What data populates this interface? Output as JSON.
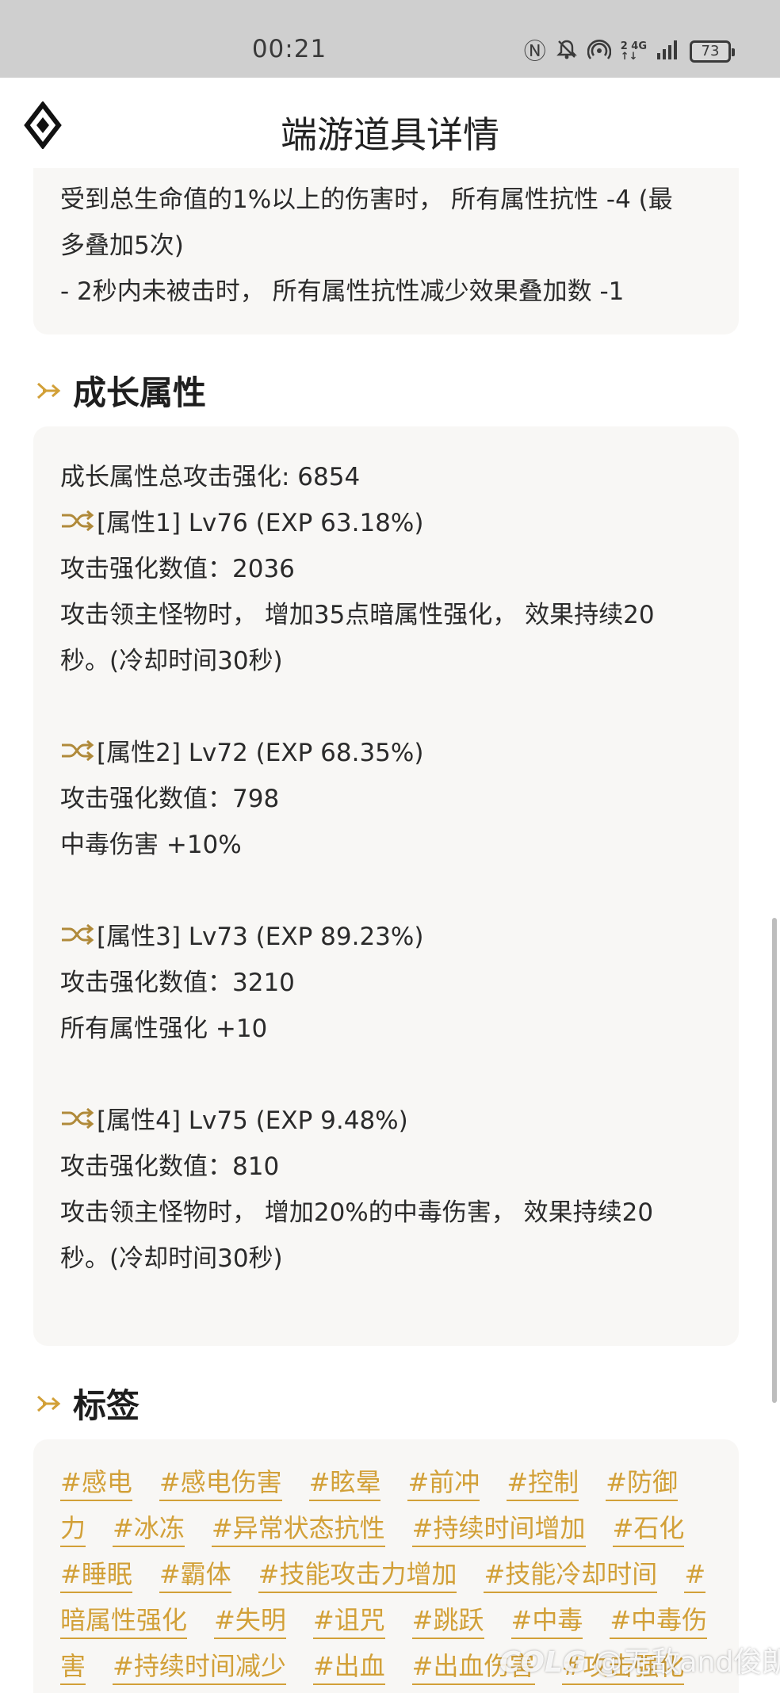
{
  "status_bar": {
    "time": "00:21",
    "net_top": "2 4G",
    "net_bottom": "↑↓",
    "battery": "73"
  },
  "header": {
    "title": "端游道具详情"
  },
  "effect_card": {
    "lines": [
      "受到总生命值的1%以上的伤害时， 所有属性抗性 -4 (最",
      "多叠加5次)",
      "- 2秒内未被击时， 所有属性抗性减少效果叠加数 -1"
    ]
  },
  "growth": {
    "section_title": "成长属性",
    "total": "成长属性总攻击强化: 6854",
    "attrs": [
      {
        "header": "[属性1] Lv76 (EXP 63.18%)",
        "value": "攻击强化数值：2036",
        "desc": [
          "攻击领主怪物时， 增加35点暗属性强化， 效果持续20",
          "秒。(冷却时间30秒)"
        ]
      },
      {
        "header": "[属性2] Lv72 (EXP 68.35%)",
        "value": "攻击强化数值：798",
        "desc": [
          "中毒伤害 +10%"
        ]
      },
      {
        "header": "[属性3] Lv73 (EXP 89.23%)",
        "value": "攻击强化数值：3210",
        "desc": [
          "所有属性强化 +10"
        ]
      },
      {
        "header": "[属性4] Lv75 (EXP 9.48%)",
        "value": "攻击强化数值：810",
        "desc": [
          "攻击领主怪物时， 增加20%的中毒伤害， 效果持续20",
          "秒。(冷却时间30秒)"
        ]
      }
    ]
  },
  "tags": {
    "section_title": "标签",
    "rows": [
      [
        "#感电",
        "#感电伤害",
        "#眩晕",
        "#前冲",
        "#控制",
        "#防御"
      ],
      [
        "力",
        "#冰冻",
        "#异常状态抗性",
        "#持续时间增加",
        "#石化"
      ],
      [
        "#睡眠",
        "#霸体",
        "#技能攻击力增加",
        "#技能冷却时间",
        "#"
      ],
      [
        "暗属性强化",
        "#失明",
        "#诅咒",
        "#跳跃",
        "#中毒",
        "#中毒伤"
      ],
      [
        "害",
        "#持续时间减少",
        "#出血",
        "#出血伤害",
        "#攻击强化"
      ]
    ]
  },
  "watermark": {
    "brand": "COLG",
    "user": "@无敌and俊朗"
  },
  "colors": {
    "accent": "#d2a038",
    "card_bg": "#f8f7f5",
    "status_bg": "#cfcfcf"
  },
  "icons": {
    "logo": "diamond-logo-icon",
    "section": "arrow-right-icon",
    "attr": "shuffle-icon"
  }
}
